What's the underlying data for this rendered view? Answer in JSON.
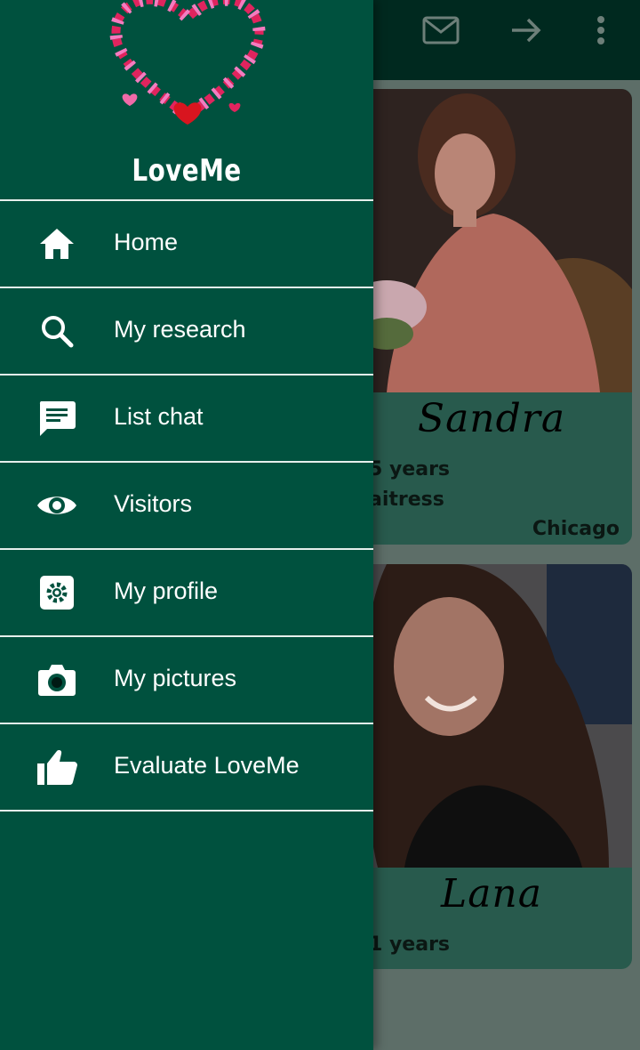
{
  "app": {
    "name": "LoveMe"
  },
  "toolbar": {
    "icons": [
      "mail-icon",
      "arrow-forward-icon",
      "more-vert-icon"
    ]
  },
  "cards": [
    {
      "name": "Sandra",
      "age": "5 years",
      "job": "aitress",
      "city": "Chicago"
    },
    {
      "name": "Lana",
      "age": "1 years",
      "job": "",
      "city": ""
    }
  ],
  "menu": {
    "items": [
      {
        "label": "Home",
        "icon": "home-icon"
      },
      {
        "label": "My research",
        "icon": "search-icon"
      },
      {
        "label": "List chat",
        "icon": "chat-icon"
      },
      {
        "label": "Visitors",
        "icon": "eye-icon"
      },
      {
        "label": "My profile",
        "icon": "settings-icon"
      },
      {
        "label": "My pictures",
        "icon": "camera-icon"
      },
      {
        "label": "Evaluate LoveMe",
        "icon": "thumb-up-icon"
      }
    ]
  },
  "colors": {
    "drawer": "#00513e",
    "appbar": "#00291f",
    "card": "#285a4d",
    "divider": "#e6efec"
  }
}
